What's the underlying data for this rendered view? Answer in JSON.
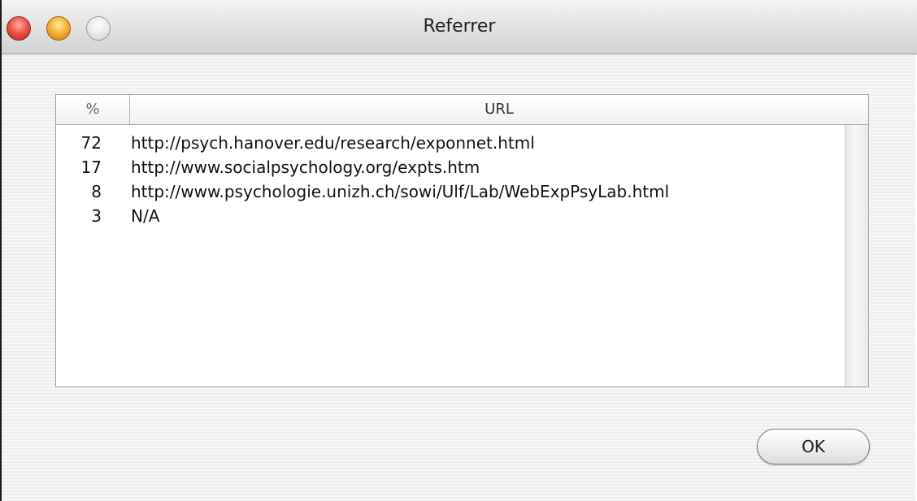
{
  "window": {
    "title": "Referrer",
    "controls": [
      "close",
      "minimize",
      "zoom"
    ]
  },
  "table": {
    "columns": [
      "%",
      "URL"
    ],
    "rows": [
      {
        "percent": "72",
        "url": "http://psych.hanover.edu/research/exponnet.html"
      },
      {
        "percent": "17",
        "url": "http://www.socialpsychology.org/expts.htm"
      },
      {
        "percent": "8",
        "url": "http://www.psychologie.unizh.ch/sowi/Ulf/Lab/WebExpPsyLab.html"
      },
      {
        "percent": "3",
        "url": "N/A"
      }
    ]
  },
  "buttons": {
    "ok_label": "OK"
  }
}
